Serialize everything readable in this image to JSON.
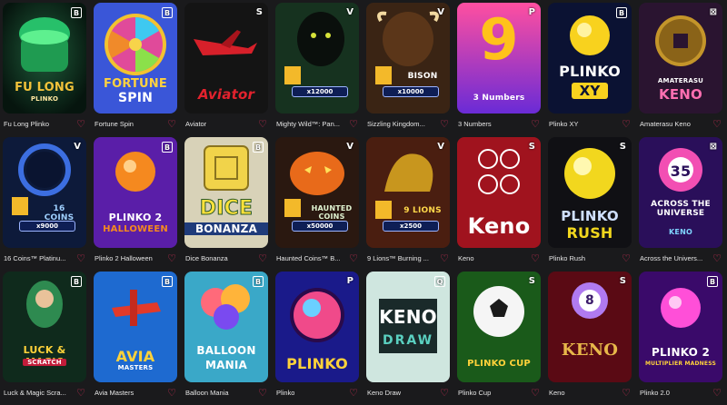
{
  "games": [
    {
      "name": "Fu Long Plinko",
      "provider": "B",
      "art": [
        "FU LONG",
        "PLINKO"
      ]
    },
    {
      "name": "Fortune Spin",
      "provider": "B",
      "art": [
        "FORTUNE",
        "SPIN"
      ]
    },
    {
      "name": "Aviator",
      "provider": "S",
      "art": [
        "Aviator"
      ]
    },
    {
      "name": "Mighty Wild™: Pan...",
      "provider": "V",
      "art": [
        "x12000"
      ]
    },
    {
      "name": "Sizzling Kingdom...",
      "provider": "V",
      "art": [
        "BISON",
        "x10000"
      ]
    },
    {
      "name": "3 Numbers",
      "provider": "P",
      "art": [
        "9",
        "3 Numbers"
      ]
    },
    {
      "name": "Plinko XY",
      "provider": "B",
      "art": [
        "PLINKO",
        "XY"
      ]
    },
    {
      "name": "Amaterasu Keno",
      "provider": "⊠",
      "art": [
        "AMATERASU",
        "KENO"
      ]
    },
    {
      "name": "16 Coins™ Platinu...",
      "provider": "V",
      "art": [
        "16 COINS",
        "x9000"
      ]
    },
    {
      "name": "Plinko 2 Halloween",
      "provider": "B",
      "art": [
        "PLINKO 2",
        "HALLOWEEN"
      ]
    },
    {
      "name": "Dice Bonanza",
      "provider": "B",
      "art": [
        "DICE",
        "BONANZA"
      ]
    },
    {
      "name": "Haunted Coins™ B...",
      "provider": "V",
      "art": [
        "HAUNTED COINS",
        "x50000"
      ]
    },
    {
      "name": "9 Lions™ Burning ...",
      "provider": "V",
      "art": [
        "9 LIONS",
        "x2500"
      ]
    },
    {
      "name": "Keno",
      "provider": "S",
      "art": [
        "Keno"
      ]
    },
    {
      "name": "Plinko Rush",
      "provider": "S",
      "art": [
        "PLINKO",
        "RUSH"
      ]
    },
    {
      "name": "Across the Univers...",
      "provider": "⊠",
      "art": [
        "ACROSS THE UNIVERSE",
        "KENO",
        "35"
      ]
    },
    {
      "name": "Luck & Magic Scra...",
      "provider": "B",
      "art": [
        "LUCK & MAGIC",
        "SCRATCH"
      ]
    },
    {
      "name": "Avia Masters",
      "provider": "B",
      "art": [
        "AVIA",
        "MASTERS"
      ]
    },
    {
      "name": "Balloon Mania",
      "provider": "B",
      "art": [
        "BALLOON",
        "MANIA"
      ]
    },
    {
      "name": "Plinko",
      "provider": "P",
      "art": [
        "PLINKO"
      ]
    },
    {
      "name": "Keno Draw",
      "provider": "Q",
      "art": [
        "KENO",
        "DRAW"
      ]
    },
    {
      "name": "Plinko Cup",
      "provider": "S",
      "art": [
        "PLINKO CUP"
      ]
    },
    {
      "name": "Keno",
      "provider": "S",
      "art": [
        "KENO",
        "8"
      ]
    },
    {
      "name": "Plinko 2.0",
      "provider": "B",
      "art": [
        "PLINKO 2",
        "MULTIPLIER MADNESS"
      ]
    }
  ],
  "heart_icon": "♡",
  "colors": {
    "heart": "#e0315b",
    "background": "#1a1a1c"
  }
}
